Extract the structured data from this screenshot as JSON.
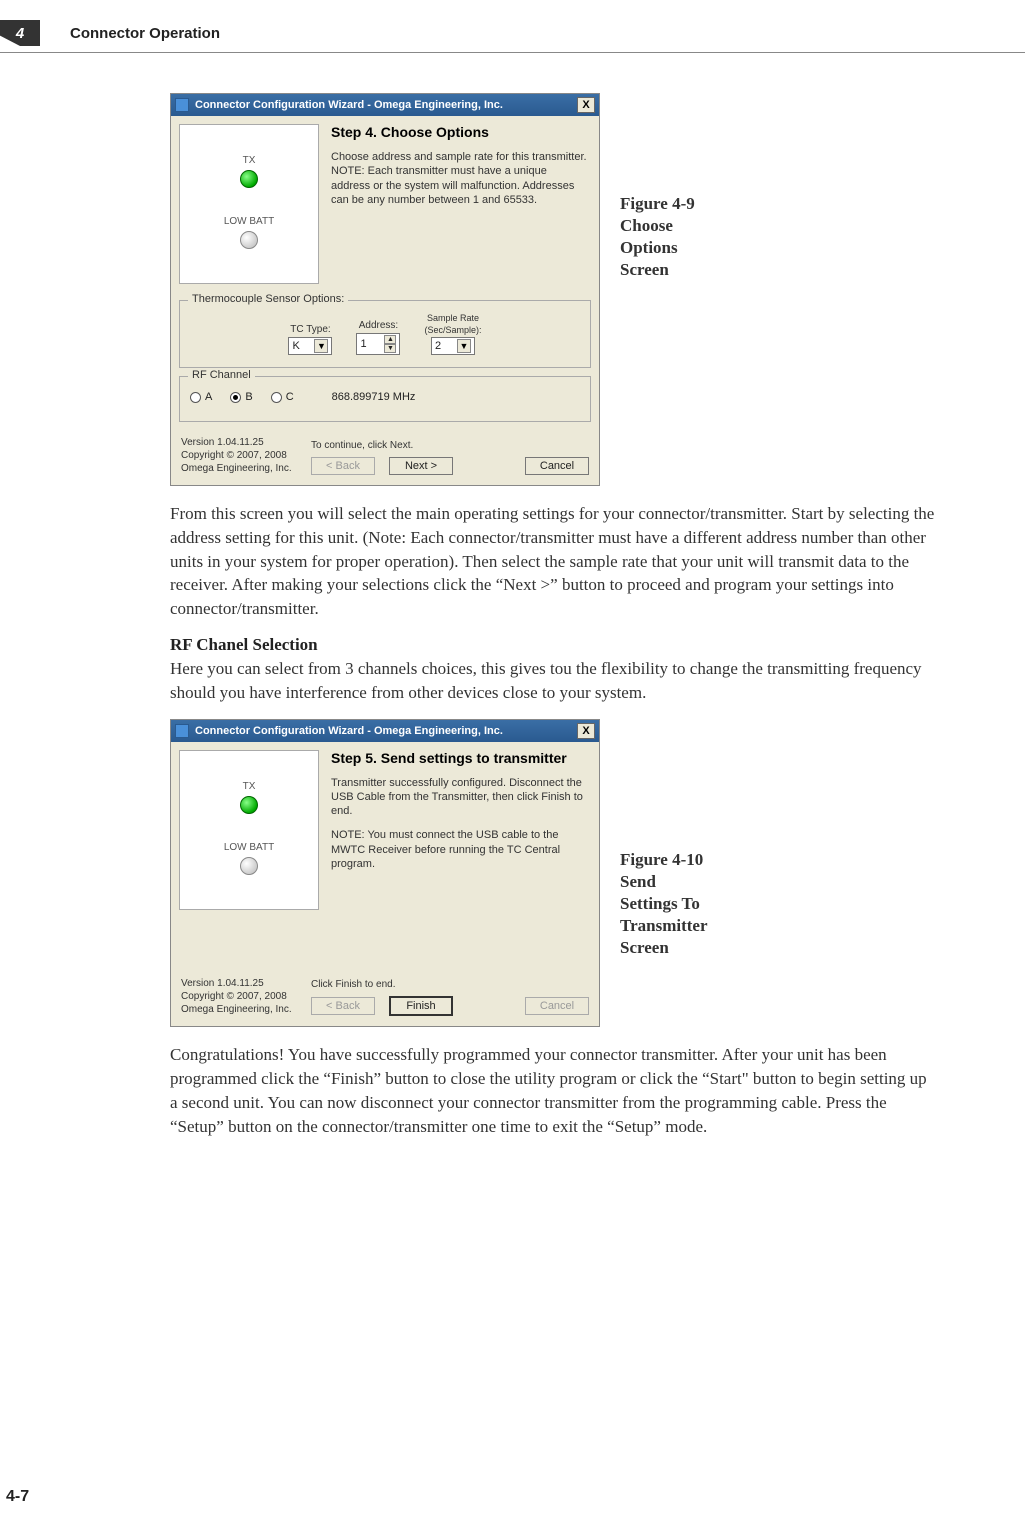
{
  "header": {
    "chapter_num": "4",
    "chapter_title": "Connector Operation"
  },
  "fig1": {
    "caption_line1": "Figure 4-9",
    "caption_line2": "Choose",
    "caption_line3": "Options",
    "caption_line4": "Screen",
    "title": "Connector Configuration Wizard - Omega Engineering, Inc.",
    "close": "X",
    "tx_label": "TX",
    "batt_label": "LOW BATT",
    "step_title": "Step 4.  Choose Options",
    "step_desc": "Choose address and sample rate for this transmitter.  NOTE: Each transmitter must have a unique address or the system will malfunction.  Addresses can be any number between 1 and 65533.",
    "groupbox1": "Thermocouple Sensor Options:",
    "tc_type_label": "TC Type:",
    "tc_type_value": "K",
    "address_label": "Address:",
    "address_value": "1",
    "sample_label1": "Sample Rate",
    "sample_label2": "(Sec/Sample):",
    "sample_value": "2",
    "groupbox2": "RF Channel",
    "opt_a": "A",
    "opt_b": "B",
    "opt_c": "C",
    "freq": "868.899719 MHz",
    "version": "Version 1.04.11.25",
    "copyright": "Copyright © 2007, 2008 Omega Engineering, Inc.",
    "hint": "To continue, click Next.",
    "back_btn": "< Back",
    "next_btn": "Next >",
    "cancel_btn": "Cancel"
  },
  "para1": "From this screen you will select the main operating settings for your connector/transmitter. Start by selecting the address setting for this unit. (Note: Each connector/transmitter must have a different address number than other units in your system for proper operation). Then select the sample rate that your unit will transmit data to the receiver. After making your selections click the “Next >” button to proceed and program your settings into connector/transmitter.",
  "subhead1": "RF Chanel Selection",
  "para2": "Here you can select from 3 channels choices, this gives tou the flexibility to change the transmitting frequency should you have interference from other devices close to your system.",
  "fig2": {
    "caption_line1": "Figure 4-10",
    "caption_line2": "Send",
    "caption_line3": "Settings To",
    "caption_line4": "Transmitter",
    "caption_line5": "Screen",
    "title": "Connector Configuration Wizard - Omega Engineering, Inc.",
    "close": "X",
    "tx_label": "TX",
    "batt_label": "LOW BATT",
    "step_title": "Step 5.  Send settings to transmitter",
    "step_desc1": "Transmitter successfully configured. Disconnect the USB Cable from the Transmitter, then click Finish to end.",
    "step_desc2": "NOTE:  You must connect the USB cable to the MWTC Receiver before running the TC Central program.",
    "version": "Version 1.04.11.25",
    "copyright": "Copyright © 2007, 2008 Omega Engineering, Inc.",
    "hint": "Click Finish to end.",
    "back_btn": "< Back",
    "finish_btn": "Finish",
    "cancel_btn": "Cancel"
  },
  "para3": "Congratulations! You have successfully programmed your connector transmitter. After your unit has been programmed click the “Finish” button to close the utility program or click the “Start\" button to begin setting up a second unit. You can now disconnect your connector transmitter from the programming cable. Press the “Setup” button on the connector/transmitter one time to exit the “Setup” mode.",
  "page_num": "4-7"
}
